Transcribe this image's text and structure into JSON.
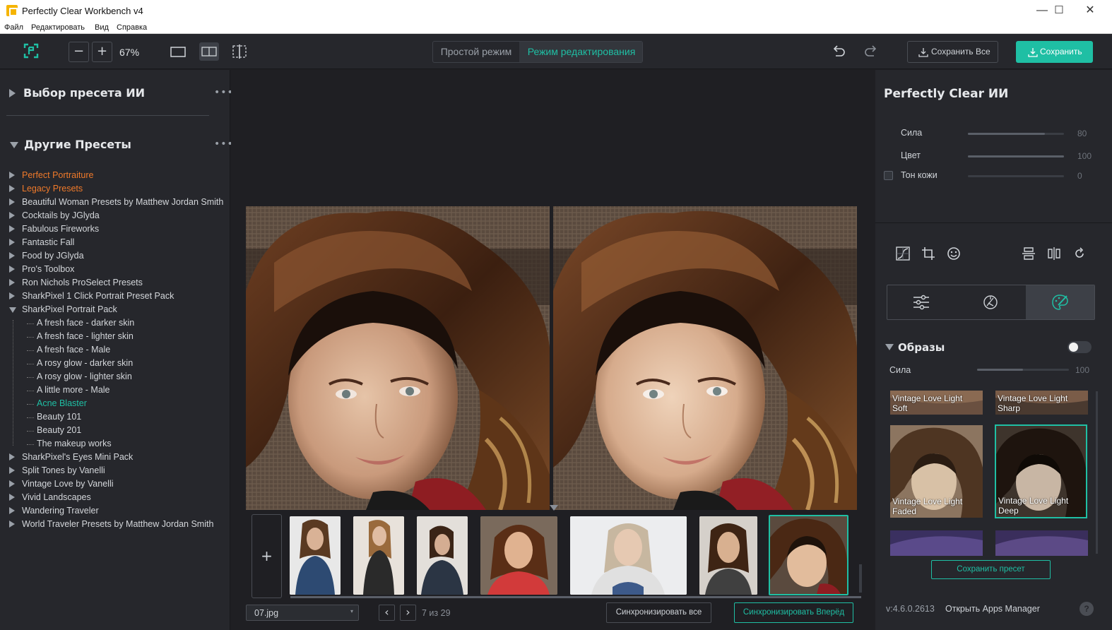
{
  "window": {
    "title": "Perfectly Clear Workbench v4",
    "minimize": "—",
    "maximize": "☐",
    "close": "✕"
  },
  "menu": [
    "Файл",
    "Редактировать",
    "Вид",
    "Справка"
  ],
  "toolbar": {
    "zoom_out": "−",
    "zoom_in": "+",
    "zoom_level": "67%",
    "mode_simple": "Простой режим",
    "mode_edit": "Режим редактирования",
    "save_all": "Сохранить Все",
    "save": "Сохранить",
    "accent": "#1fbfa4"
  },
  "left": {
    "ai_preset_title": "Выбор пресета ИИ",
    "other_presets_title": "Другие Пресеты",
    "more": "•••",
    "tree": [
      {
        "label": "Perfect Portraiture",
        "color": "#f07a2a",
        "expanded": false
      },
      {
        "label": "Legacy Presets",
        "color": "#f07a2a",
        "expanded": false
      },
      {
        "label": "Beautiful Woman Presets by Matthew Jordan Smith",
        "expanded": false
      },
      {
        "label": "Cocktails by JGlyda",
        "expanded": false
      },
      {
        "label": "Fabulous Fireworks",
        "expanded": false
      },
      {
        "label": "Fantastic Fall",
        "expanded": false
      },
      {
        "label": "Food by JGlyda",
        "expanded": false
      },
      {
        "label": "Pro's Toolbox",
        "expanded": false
      },
      {
        "label": "Ron Nichols ProSelect Presets",
        "expanded": false
      },
      {
        "label": "SharkPixel 1 Click Portrait Preset Pack",
        "expanded": false
      },
      {
        "label": "SharkPixel Portrait Pack",
        "expanded": true
      },
      {
        "label": "SharkPixel's Eyes Mini Pack",
        "expanded": false
      },
      {
        "label": "Split Tones by Vanelli",
        "expanded": false
      },
      {
        "label": "Vintage Love by Vanelli",
        "expanded": false
      },
      {
        "label": "Vivid Landscapes",
        "expanded": false
      },
      {
        "label": "Wandering Traveler",
        "expanded": false
      },
      {
        "label": "World Traveler Presets by Matthew Jordan Smith",
        "expanded": false
      }
    ],
    "children": [
      {
        "label": "A fresh face - darker skin"
      },
      {
        "label": "A fresh face - lighter skin"
      },
      {
        "label": "A fresh face - Male"
      },
      {
        "label": "A rosy glow - darker skin"
      },
      {
        "label": "A rosy glow - lighter skin"
      },
      {
        "label": "A little more - Male"
      },
      {
        "label": "Acne Blaster",
        "color": "#1fbfa4"
      },
      {
        "label": "Beauty 101"
      },
      {
        "label": "Beauty 201"
      },
      {
        "label": "The makeup works"
      }
    ]
  },
  "filmstrip": {
    "add": "+",
    "file_name": "07.jpg",
    "prev": "‹",
    "next": "›",
    "counter": "7 из 29",
    "sync_all": "Синхронизировать все",
    "sync_forward": "Синхронизировать Вперёд"
  },
  "right": {
    "ai_title": "Perfectly Clear ИИ",
    "sliders": [
      {
        "label": "Сила",
        "value": "80",
        "level": 0.8
      },
      {
        "label": "Цвет",
        "value": "100",
        "level": 1.0
      },
      {
        "label": "Тон кожи",
        "value": "0",
        "level": 0.0
      }
    ],
    "looks_title": "Образы",
    "looks_strength_label": "Сила",
    "looks_strength_value": "100",
    "looks_strength_level": 0.5,
    "looks": [
      {
        "line1": "Vintage Love Light",
        "line2": "Soft"
      },
      {
        "line1": "Vintage Love Light",
        "line2": "Sharp"
      },
      {
        "line1": "Vintage Love Light",
        "line2": "Faded"
      },
      {
        "line1": "Vintage Love Light",
        "line2": "Deep"
      }
    ],
    "save_preset": "Сохранить пресет",
    "version": "v:4.6.0.2613",
    "apps_manager": "Открыть Apps Manager",
    "help": "?"
  }
}
